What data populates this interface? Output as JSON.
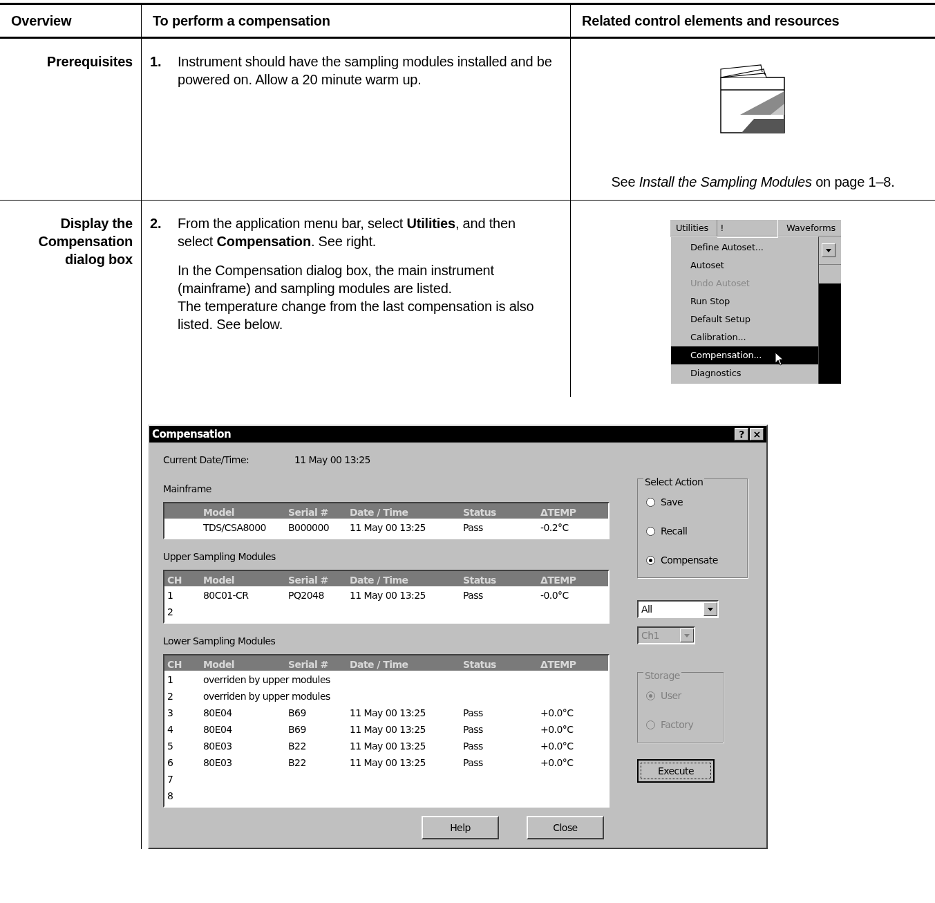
{
  "headers": [
    "Overview",
    "To perform a compensation",
    "Related control elements and resources"
  ],
  "rows": [
    {
      "label": "Prerequisites",
      "steps": [
        {
          "number": "1.",
          "paragraphs": [
            "Instrument should have the sampling modules installed and be powered on. Allow a 20 minute warm up."
          ]
        }
      ],
      "resource": {
        "kind": "book",
        "caption": "See *Install the Sampling Modules* on page 1–8."
      }
    },
    {
      "label": "Display the Compensation dialog box",
      "steps": [
        {
          "number": "2.",
          "paragraphs": [
            "From the application menu bar, select **Utilities**, and then select **Compensation**. See right.",
            "In the Compensation dialog box, the main instrument (mainframe) and sampling modules are listed.\nThe temperature change from the last compensation is also listed. See below."
          ]
        }
      ],
      "resource": {
        "kind": "menu",
        "bar": [
          "Utilities",
          "!",
          "Waveforms"
        ],
        "items": [
          {
            "label": "Define Autoset...",
            "disabled": false,
            "selected": false
          },
          {
            "label": "Autoset",
            "disabled": false,
            "selected": false
          },
          {
            "label": "Undo Autoset",
            "disabled": true,
            "selected": false
          },
          {
            "label": "Run Stop",
            "disabled": false,
            "selected": false
          },
          {
            "label": "Default Setup",
            "disabled": false,
            "selected": false
          },
          {
            "label": "Calibration...",
            "disabled": false,
            "selected": false
          },
          {
            "label": "Compensation...",
            "disabled": false,
            "selected": true
          },
          {
            "label": "Diagnostics",
            "disabled": false,
            "selected": false
          }
        ]
      }
    }
  ],
  "dialog": {
    "title": "Compensation",
    "title_buttons": [
      "?",
      "×"
    ],
    "current_label": "Current Date/Time:",
    "current_value": "11 May 00 13:25",
    "sections": [
      {
        "title": "Mainframe",
        "columns": [
          "",
          "Model",
          "Serial #",
          "Date / Time",
          "Status",
          "ΔTEMP"
        ],
        "rows": [
          [
            "",
            "TDS/CSA8000",
            "B000000",
            "11 May 00 13:25",
            "Pass",
            "-0.2°C"
          ]
        ]
      },
      {
        "title": "Upper Sampling Modules",
        "columns": [
          "CH",
          "Model",
          "Serial #",
          "Date / Time",
          "Status",
          "ΔTEMP"
        ],
        "rows": [
          [
            "1",
            "80C01-CR",
            "PQ2048",
            "11 May 00 13:25",
            "Pass",
            "-0.0°C"
          ],
          [
            "2"
          ]
        ]
      },
      {
        "title": "Lower Sampling Modules",
        "columns": [
          "CH",
          "Model",
          "Serial #",
          "Date / Time",
          "Status",
          "ΔTEMP"
        ],
        "rows": [
          [
            "1",
            "overriden by upper modules"
          ],
          [
            "2",
            "overriden by upper modules"
          ],
          [
            "3",
            "80E04",
            "B69",
            "11 May 00 13:25",
            "Pass",
            "+0.0°C"
          ],
          [
            "4",
            "80E04",
            "B69",
            "11 May 00 13:25",
            "Pass",
            "+0.0°C"
          ],
          [
            "5",
            "80E03",
            "B22",
            "11 May 00 13:25",
            "Pass",
            "+0.0°C"
          ],
          [
            "6",
            "80E03",
            "B22",
            "11 May 00 13:25",
            "Pass",
            "+0.0°C"
          ],
          [
            "7"
          ],
          [
            "8"
          ]
        ]
      }
    ],
    "select_action": {
      "title": "Select Action",
      "options": [
        {
          "label": "Save",
          "selected": false
        },
        {
          "label": "Recall",
          "selected": false
        },
        {
          "label": "Compensate",
          "selected": true
        }
      ]
    },
    "dropdowns": [
      {
        "value": "All",
        "disabled": false
      },
      {
        "value": "Ch1",
        "disabled": true
      }
    ],
    "storage": {
      "title": "Storage",
      "disabled": true,
      "options": [
        {
          "label": "User",
          "selected": true
        },
        {
          "label": "Factory",
          "selected": false
        }
      ]
    },
    "execute": "Execute",
    "buttons": [
      "Help",
      "Close"
    ]
  }
}
